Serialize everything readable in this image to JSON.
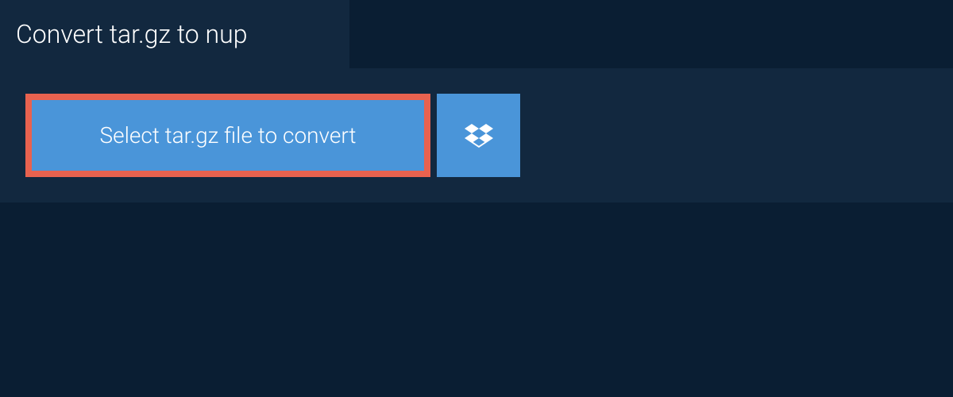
{
  "tab": {
    "title": "Convert tar.gz to nup"
  },
  "actions": {
    "select_file_label": "Select tar.gz file to convert"
  },
  "colors": {
    "page_bg": "#0a1e33",
    "panel_bg": "#12283f",
    "button_bg": "#4a95d9",
    "button_border": "#e8624f",
    "text": "#ffffff"
  }
}
